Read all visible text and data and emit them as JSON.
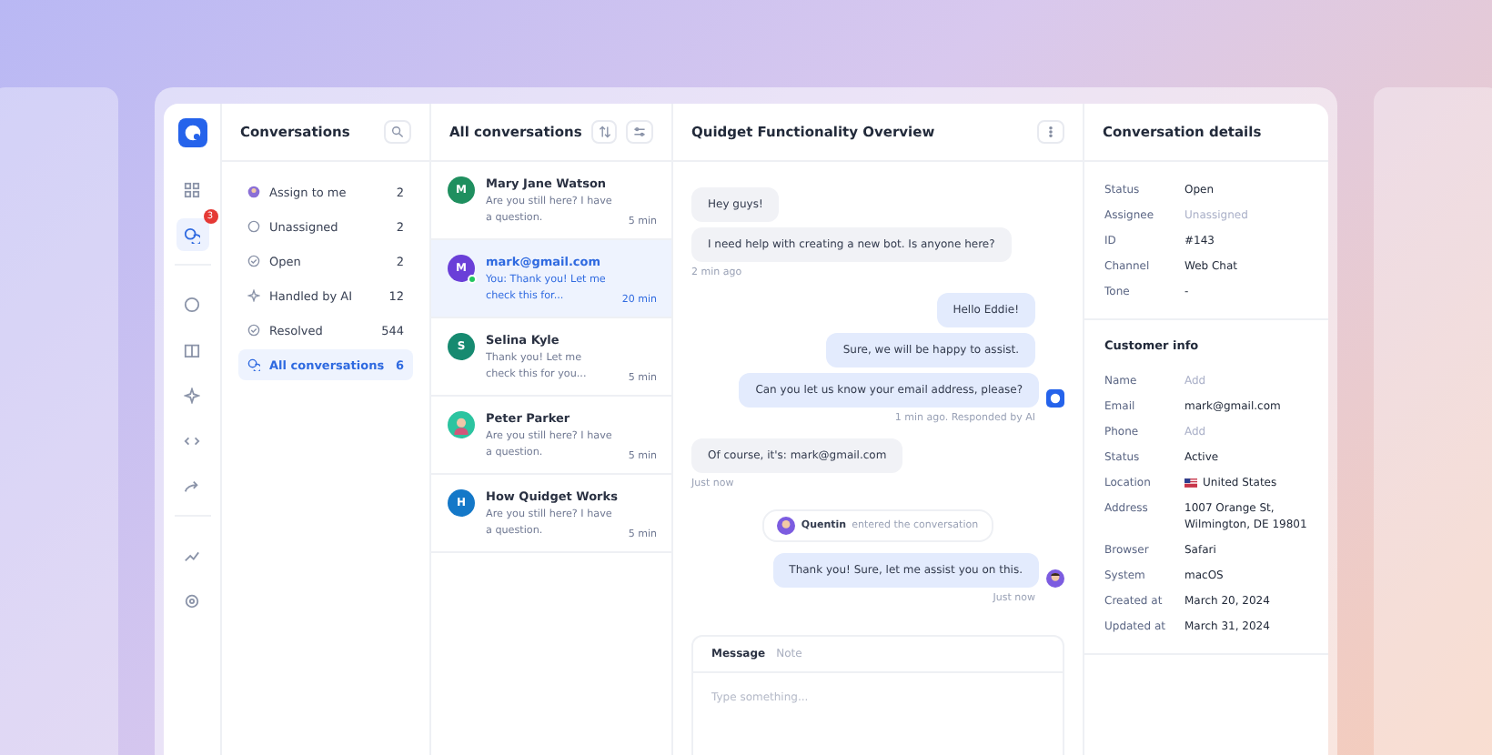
{
  "rail": [
    {
      "selected": false
    },
    {
      "selected": true,
      "badge": "3"
    },
    {
      "selected": false
    },
    {
      "selected": false
    },
    {
      "selected": false
    },
    {
      "selected": false
    },
    {
      "selected": false
    },
    {
      "selected": false
    },
    {
      "selected": false
    }
  ],
  "nav": {
    "title": "Conversations",
    "items": [
      {
        "label": "Assign to me",
        "count": "2",
        "selected": false
      },
      {
        "label": "Unassigned",
        "count": "2",
        "selected": false
      },
      {
        "label": "Open",
        "count": "2",
        "selected": false
      },
      {
        "label": "Handled by AI",
        "count": "12",
        "selected": false
      },
      {
        "label": "Resolved",
        "count": "544",
        "selected": false
      },
      {
        "label": "All conversations",
        "count": "6",
        "selected": true
      }
    ]
  },
  "list": {
    "title": "All conversations",
    "items": [
      {
        "name": "Mary Jane Watson",
        "initial": "M",
        "color": "#1f8f5f",
        "preview": "Are you still here? I have a question.",
        "time": "5 min",
        "selected": false
      },
      {
        "name": "mark@gmail.com",
        "initial": "M",
        "color": "#6a3fd8",
        "preview": "You: Thank you! Let me check this for...",
        "time": "20 min",
        "selected": true,
        "online": true
      },
      {
        "name": "Selina Kyle",
        "initial": "S",
        "color": "#168a70",
        "preview": "Thank you! Let me check this for you...",
        "time": "5 min",
        "selected": false
      },
      {
        "name": "Peter Parker",
        "kind": "photo",
        "color": "#2cc4a0",
        "preview": "Are you still here? I have a question.",
        "time": "5 min",
        "selected": false
      },
      {
        "name": "How Quidget Works",
        "initial": "H",
        "color": "#1478c8",
        "preview": "Are you still here? I have a question.",
        "time": "5 min",
        "selected": false
      }
    ]
  },
  "chat": {
    "title": "Quidget Functionality Overview",
    "messages": [
      {
        "kind": "incoming",
        "text": "Hey guys!"
      },
      {
        "kind": "incoming",
        "text": "I need help with creating a new bot. Is anyone here?"
      },
      {
        "kind": "incomingtime",
        "text": "2 min ago"
      },
      {
        "kind": "outgoing",
        "text": "Hello Eddie!"
      },
      {
        "kind": "outgoing",
        "text": "Sure, we will be happy to assist."
      },
      {
        "kind": "botreply",
        "text": "Can you let us know your email address, please?"
      },
      {
        "kind": "outgoingtime",
        "text": "1 min ago. Responded by AI"
      },
      {
        "kind": "incoming",
        "text": "Of course, it's: mark@gmail.com"
      },
      {
        "kind": "incomingtime",
        "text": "Just now"
      },
      {
        "kind": "event",
        "name": "Quentin",
        "text": "entered the conversation"
      },
      {
        "kind": "agentreply",
        "text": "Thank you! Sure, let me assist you on this."
      },
      {
        "kind": "outgoingtime",
        "text": "Just now"
      }
    ],
    "composer": {
      "tabs": [
        {
          "label": "Message",
          "selected": true
        },
        {
          "label": "Note",
          "selected": false
        }
      ],
      "placeholder": "Type something..."
    }
  },
  "details": {
    "title": "Conversation details",
    "sections": [
      {
        "rows": [
          {
            "label": "Status",
            "value": "Open",
            "muted": false
          },
          {
            "label": "Assignee",
            "value": "Unassigned",
            "muted": true
          },
          {
            "label": "ID",
            "value": "#143",
            "muted": false
          },
          {
            "label": "Channel",
            "value": "Web Chat",
            "muted": false
          },
          {
            "label": "Tone",
            "value": "-",
            "muted": false
          }
        ]
      },
      {
        "title": "Customer info",
        "rows": [
          {
            "label": "Name",
            "value": "Add",
            "muted": true
          },
          {
            "label": "Email",
            "value": "mark@gmail.com",
            "muted": false
          },
          {
            "label": "Phone",
            "value": "Add",
            "muted": true
          },
          {
            "label": "Status",
            "value": "Active",
            "muted": false
          },
          {
            "label": "Location",
            "value": "United States",
            "muted": false,
            "flag": true
          },
          {
            "label": "Address",
            "value": "1007 Orange St, Wilmington, DE 19801",
            "muted": false
          },
          {
            "label": "Browser",
            "value": "Safari",
            "muted": false
          },
          {
            "label": "System",
            "value": "macOS",
            "muted": false
          },
          {
            "label": "Created at",
            "value": "March 20, 2024",
            "muted": false
          },
          {
            "label": "Updated at",
            "value": "March 31, 2024",
            "muted": false
          }
        ]
      }
    ]
  }
}
